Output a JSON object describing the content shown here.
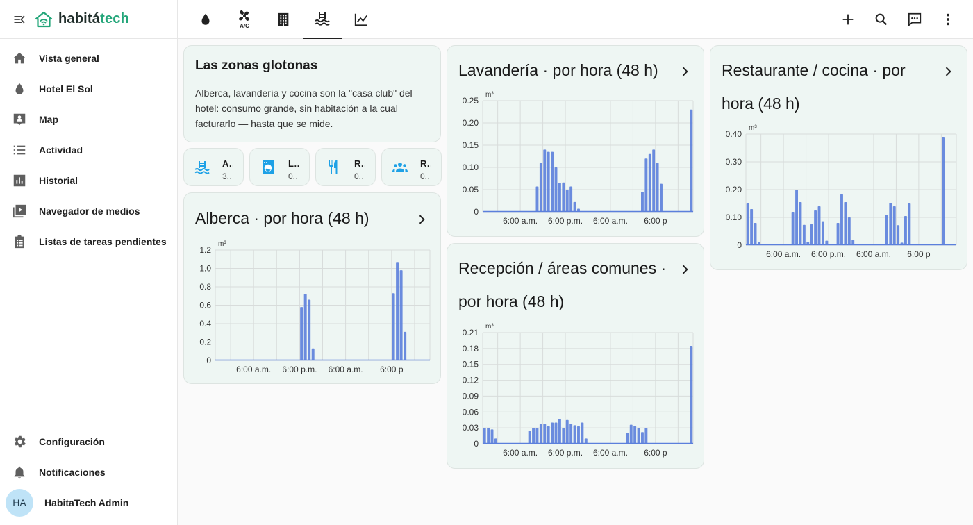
{
  "app": {
    "logo_text_main": "habitá",
    "logo_text_accent": "tech",
    "accent_color": "#24a67a"
  },
  "sidebar": {
    "items": [
      {
        "label": "Vista general",
        "icon": "home-icon"
      },
      {
        "label": "Hotel El Sol",
        "icon": "water-drop-icon"
      },
      {
        "label": "Map",
        "icon": "map-account-icon"
      },
      {
        "label": "Actividad",
        "icon": "list-icon"
      },
      {
        "label": "Historial",
        "icon": "bar-chart-icon"
      },
      {
        "label": "Navegador de medios",
        "icon": "media-play-icon"
      },
      {
        "label": "Listas de tareas pendientes",
        "icon": "clipboard-list-icon"
      }
    ],
    "bottom": [
      {
        "label": "Configuración",
        "icon": "gear-icon"
      },
      {
        "label": "Notificaciones",
        "icon": "bell-icon"
      }
    ],
    "user": {
      "initials": "HA",
      "name": "HabitaTech Admin"
    }
  },
  "topbar": {
    "tabs": [
      {
        "icon": "water-drop-icon",
        "active": false
      },
      {
        "icon": "air-conditioner-icon",
        "text": "A/C",
        "active": false
      },
      {
        "icon": "building-icon",
        "active": false
      },
      {
        "icon": "pool-icon",
        "active": true
      },
      {
        "icon": "line-chart-icon",
        "active": false
      }
    ],
    "actions": [
      "add-icon",
      "search-icon",
      "assist-chat-icon",
      "more-vert-icon"
    ]
  },
  "intro_card": {
    "title": "Las zonas glotonas",
    "body": "Alberca, lavandería y cocina son la \"casa club\" del hotel: consumo grande, sin habitación a la cual facturarlo — hasta que se mide."
  },
  "tiles": [
    {
      "name": "A…",
      "value": "3.…",
      "icon": "pool-icon"
    },
    {
      "name": "L…",
      "value": "0.…",
      "icon": "washing-machine-icon"
    },
    {
      "name": "R…",
      "value": "0.…",
      "icon": "silverware-icon"
    },
    {
      "name": "R…",
      "value": "0.…",
      "icon": "account-group-icon"
    }
  ],
  "charts_text": {
    "alberca": {
      "title": "Alberca · por hora (48 h)"
    },
    "lavanderia": {
      "title": "Lavandería · por hora (48 h)"
    },
    "recepcion": {
      "title_line1": "Recepción / áreas comunes ·",
      "title_line2": "por hora (48 h)"
    },
    "restaurante": {
      "title_line1": "Restaurante / cocina · por",
      "title_line2": "hora (48 h)"
    }
  },
  "chart_data": [
    {
      "id": "alberca",
      "type": "bar",
      "title": "Alberca · por hora (48 h)",
      "unit": "m³",
      "ylim": [
        0,
        1.2
      ],
      "yticks": [
        "0",
        "0.2",
        "0.4",
        "0.6",
        "0.8",
        "1.0",
        "1.2"
      ],
      "xticks": [
        "6:00 a.m.",
        "6:00 p.m.",
        "6:00 a.m.",
        "6:00 p"
      ],
      "color": "#5b7fdc",
      "grid": true,
      "values": [
        0,
        0,
        0,
        0,
        0,
        0,
        0,
        0,
        0,
        0,
        0,
        0,
        0,
        0,
        0,
        0,
        0,
        0,
        0,
        0,
        0,
        0,
        0.58,
        0.72,
        0.66,
        0.13,
        0,
        0,
        0,
        0,
        0,
        0,
        0,
        0,
        0,
        0,
        0,
        0,
        0,
        0,
        0,
        0,
        0,
        0,
        0,
        0,
        0.73,
        1.07,
        0.98,
        0.31,
        0,
        0,
        0,
        0,
        0,
        0
      ]
    },
    {
      "id": "lavanderia",
      "type": "bar",
      "title": "Lavandería · por hora (48 h)",
      "unit": "m³",
      "ylim": [
        0,
        0.25
      ],
      "yticks": [
        "0",
        "0.05",
        "0.10",
        "0.15",
        "0.20",
        "0.25"
      ],
      "xticks": [
        "6:00 a.m.",
        "6:00 p.m.",
        "6:00 a.m.",
        "6:00 p"
      ],
      "color": "#5b7fdc",
      "grid": true,
      "values": [
        0,
        0,
        0,
        0,
        0,
        0,
        0,
        0,
        0,
        0,
        0,
        0,
        0,
        0,
        0.057,
        0.11,
        0.14,
        0.135,
        0.135,
        0.1,
        0.065,
        0.066,
        0.05,
        0.057,
        0.022,
        0.007,
        0,
        0,
        0,
        0,
        0,
        0,
        0,
        0,
        0,
        0,
        0,
        0,
        0,
        0,
        0,
        0,
        0.045,
        0.12,
        0.13,
        0.14,
        0.11,
        0.063,
        0,
        0,
        0,
        0,
        0,
        0,
        0,
        0.23
      ]
    },
    {
      "id": "recepcion",
      "type": "bar",
      "title": "Recepción / áreas comunes · por hora (48 h)",
      "unit": "m³",
      "ylim": [
        0,
        0.21
      ],
      "yticks": [
        "0",
        "0.03",
        "0.06",
        "0.09",
        "0.12",
        "0.15",
        "0.18",
        "0.21"
      ],
      "xticks": [
        "6:00 a.m.",
        "6:00 p.m.",
        "6:00 a.m.",
        "6:00 p"
      ],
      "color": "#5b7fdc",
      "grid": true,
      "values": [
        0.03,
        0.03,
        0.027,
        0.01,
        0,
        0,
        0,
        0,
        0,
        0,
        0,
        0,
        0.025,
        0.03,
        0.03,
        0.038,
        0.038,
        0.033,
        0.04,
        0.04,
        0.047,
        0.03,
        0.045,
        0.038,
        0.035,
        0.033,
        0.04,
        0.01,
        0,
        0,
        0,
        0,
        0,
        0,
        0,
        0,
        0,
        0,
        0.02,
        0.036,
        0.034,
        0.03,
        0.022,
        0.03,
        0,
        0,
        0,
        0,
        0,
        0,
        0,
        0,
        0,
        0,
        0,
        0.185
      ]
    },
    {
      "id": "restaurante",
      "type": "bar",
      "title": "Restaurante / cocina · por hora (48 h)",
      "unit": "m³",
      "ylim": [
        0,
        0.4
      ],
      "yticks": [
        "0",
        "0.10",
        "0.20",
        "0.30",
        "0.40"
      ],
      "xticks": [
        "6:00 a.m.",
        "6:00 p.m.",
        "6:00 a.m.",
        "6:00 p"
      ],
      "color": "#5b7fdc",
      "grid": true,
      "values": [
        0.15,
        0.13,
        0.08,
        0.012,
        0,
        0,
        0,
        0,
        0,
        0,
        0,
        0,
        0.12,
        0.2,
        0.155,
        0.073,
        0.012,
        0.075,
        0.125,
        0.14,
        0.086,
        0.016,
        0,
        0,
        0.08,
        0.183,
        0.155,
        0.1,
        0.019,
        0,
        0,
        0,
        0,
        0,
        0,
        0,
        0,
        0.11,
        0.152,
        0.14,
        0.072,
        0.009,
        0.105,
        0.15,
        0,
        0,
        0,
        0,
        0,
        0,
        0,
        0,
        0.39,
        0,
        0,
        0
      ]
    }
  ]
}
